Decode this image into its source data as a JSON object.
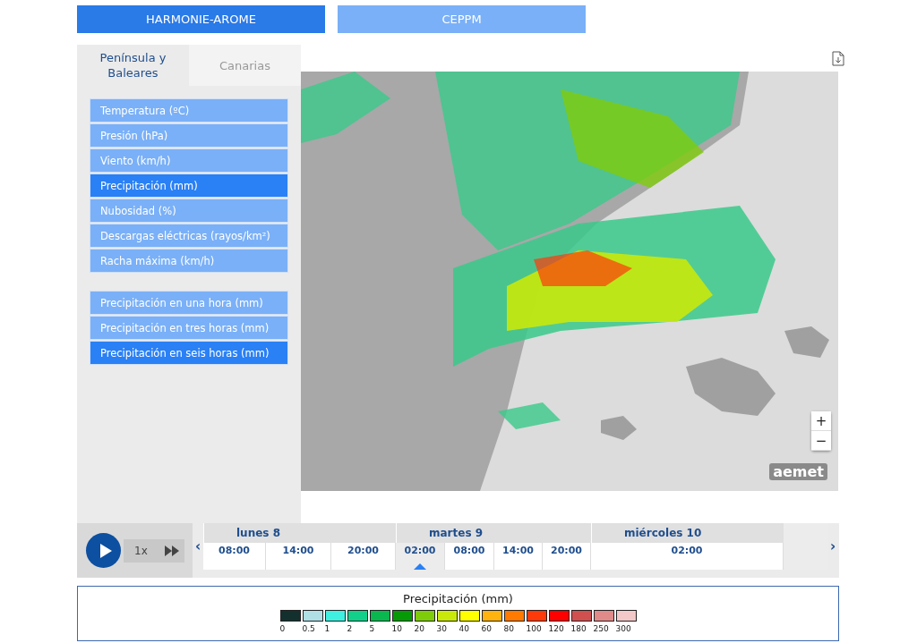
{
  "model_tabs": [
    {
      "label": "HARMONIE-AROME",
      "selected": true
    },
    {
      "label": "CEPPM",
      "selected": false
    }
  ],
  "region_tabs": [
    {
      "label": "Península y Baleares",
      "selected": true
    },
    {
      "label": "Canarias",
      "selected": false
    }
  ],
  "variable_groups": [
    [
      {
        "label": "Temperatura (ºC)",
        "selected": false
      },
      {
        "label": "Presión (hPa)",
        "selected": false
      },
      {
        "label": "Viento (km/h)",
        "selected": false
      },
      {
        "label": "Precipitación (mm)",
        "selected": true
      },
      {
        "label": "Nubosidad (%)",
        "selected": false
      },
      {
        "label": "Descargas eléctricas (rayos/km²)",
        "selected": false
      },
      {
        "label": "Racha máxima (km/h)",
        "selected": false
      }
    ],
    [
      {
        "label": "Precipitación en una hora (mm)",
        "selected": false
      },
      {
        "label": "Precipitación en tres horas (mm)",
        "selected": false
      },
      {
        "label": "Precipitación en seis horas (mm)",
        "selected": true
      }
    ]
  ],
  "map": {
    "zoom_in": "+",
    "zoom_out": "−",
    "logo": "aemet"
  },
  "timeline": {
    "speed": "1x",
    "prev": "‹",
    "next": "›",
    "days": [
      {
        "label": "lunes 8"
      },
      {
        "label": "martes 9"
      },
      {
        "label": "miércoles 10"
      }
    ],
    "hours": [
      {
        "label": "08:00",
        "selected": false
      },
      {
        "label": "14:00",
        "selected": false
      },
      {
        "label": "20:00",
        "selected": false
      },
      {
        "label": "02:00",
        "selected": true
      },
      {
        "label": "08:00",
        "selected": false
      },
      {
        "label": "14:00",
        "selected": false
      },
      {
        "label": "20:00",
        "selected": false
      },
      {
        "label": "02:00",
        "selected": false
      }
    ]
  },
  "legend": {
    "title": "Precipitación (mm)",
    "steps": [
      {
        "color": "#13302f",
        "label": "0"
      },
      {
        "color": "#b0dfe6",
        "label": "0.5"
      },
      {
        "color": "#3ff0e0",
        "label": "1"
      },
      {
        "color": "#12d08a",
        "label": "2"
      },
      {
        "color": "#09b84e",
        "label": "5"
      },
      {
        "color": "#069a06",
        "label": "10"
      },
      {
        "color": "#7fcc0a",
        "label": "20"
      },
      {
        "color": "#c9e90a",
        "label": "30"
      },
      {
        "color": "#ffff00",
        "label": "40"
      },
      {
        "color": "#ffb30f",
        "label": "60"
      },
      {
        "color": "#ff7a00",
        "label": "80"
      },
      {
        "color": "#ff3a0a",
        "label": "100"
      },
      {
        "color": "#ff0000",
        "label": "120"
      },
      {
        "color": "#d05050",
        "label": "180"
      },
      {
        "color": "#e08a8a",
        "label": "250"
      },
      {
        "color": "#f2c8c8",
        "label": "300"
      }
    ]
  }
}
